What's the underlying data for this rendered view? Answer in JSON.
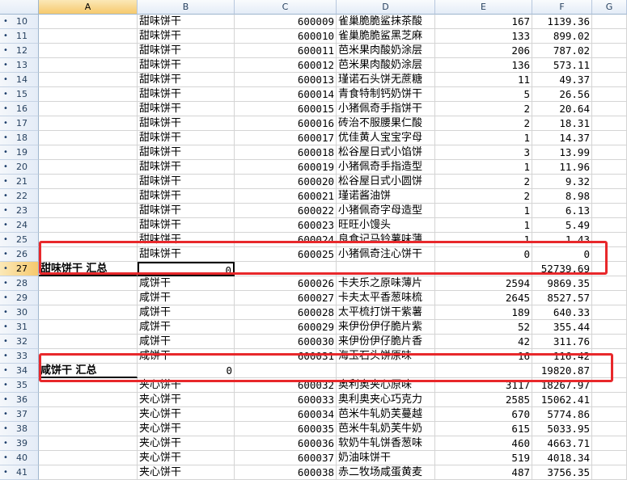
{
  "columns": [
    "A",
    "B",
    "C",
    "D",
    "E",
    "F",
    "G"
  ],
  "selected_column": "A",
  "rows": [
    {
      "row": "10",
      "a": "",
      "b": "甜味饼干",
      "c": "600009",
      "d": "雀巢脆脆鲨抹茶酸",
      "e": "167",
      "f": "1139.36"
    },
    {
      "row": "11",
      "a": "",
      "b": "甜味饼干",
      "c": "600010",
      "d": "雀巢脆脆鲨黑芝麻",
      "e": "133",
      "f": "899.02"
    },
    {
      "row": "12",
      "a": "",
      "b": "甜味饼干",
      "c": "600011",
      "d": "芭米果肉酸奶涂层",
      "e": "206",
      "f": "787.02"
    },
    {
      "row": "13",
      "a": "",
      "b": "甜味饼干",
      "c": "600012",
      "d": "芭米果肉酸奶涂层",
      "e": "136",
      "f": "573.11"
    },
    {
      "row": "14",
      "a": "",
      "b": "甜味饼干",
      "c": "600013",
      "d": "瑾诺石头饼无蔗糖",
      "e": "11",
      "f": "49.37"
    },
    {
      "row": "15",
      "a": "",
      "b": "甜味饼干",
      "c": "600014",
      "d": "青食特制钙奶饼干",
      "e": "5",
      "f": "26.56"
    },
    {
      "row": "16",
      "a": "",
      "b": "甜味饼干",
      "c": "600015",
      "d": "小猪佩奇手指饼干",
      "e": "2",
      "f": "20.64"
    },
    {
      "row": "17",
      "a": "",
      "b": "甜味饼干",
      "c": "600016",
      "d": "砖治不服腰果仁酸",
      "e": "2",
      "f": "18.31"
    },
    {
      "row": "18",
      "a": "",
      "b": "甜味饼干",
      "c": "600017",
      "d": "优佳黄人宝宝字母",
      "e": "1",
      "f": "14.37"
    },
    {
      "row": "19",
      "a": "",
      "b": "甜味饼干",
      "c": "600018",
      "d": "松谷屋日式小馅饼",
      "e": "3",
      "f": "13.99"
    },
    {
      "row": "20",
      "a": "",
      "b": "甜味饼干",
      "c": "600019",
      "d": "小猪佩奇手指造型",
      "e": "1",
      "f": "11.96"
    },
    {
      "row": "21",
      "a": "",
      "b": "甜味饼干",
      "c": "600020",
      "d": "松谷屋日式小圆饼",
      "e": "2",
      "f": "9.32"
    },
    {
      "row": "22",
      "a": "",
      "b": "甜味饼干",
      "c": "600021",
      "d": "瑾诺酱油饼",
      "e": "2",
      "f": "8.98"
    },
    {
      "row": "23",
      "a": "",
      "b": "甜味饼干",
      "c": "600022",
      "d": "小猪佩奇字母造型",
      "e": "1",
      "f": "6.13"
    },
    {
      "row": "24",
      "a": "",
      "b": "甜味饼干",
      "c": "600023",
      "d": "旺旺小馒头",
      "e": "1",
      "f": "5.49"
    },
    {
      "row": "25",
      "a": "",
      "b": "甜味饼干",
      "c": "600024",
      "d": "良食记马铃薯味薄",
      "e": "1",
      "f": "1.43"
    },
    {
      "row": "26",
      "a": "",
      "b": "甜味饼干",
      "c": "600025",
      "d": "小猪佩奇注心饼干",
      "e": "0",
      "f": "0"
    },
    {
      "row": "27",
      "a": "甜味饼干 汇总",
      "b": "0",
      "c": "",
      "d": "",
      "e": "",
      "f": "52739.69",
      "summary": true
    },
    {
      "row": "28",
      "a": "",
      "b": "咸饼干",
      "c": "600026",
      "d": "卡夫乐之原味薄片",
      "e": "2594",
      "f": "9869.35"
    },
    {
      "row": "29",
      "a": "",
      "b": "咸饼干",
      "c": "600027",
      "d": "卡夫太平香葱味梳",
      "e": "2645",
      "f": "8527.57"
    },
    {
      "row": "30",
      "a": "",
      "b": "咸饼干",
      "c": "600028",
      "d": "太平梳打饼干紫薯",
      "e": "189",
      "f": "640.33"
    },
    {
      "row": "31",
      "a": "",
      "b": "咸饼干",
      "c": "600029",
      "d": "来伊份伊仔脆片紫",
      "e": "52",
      "f": "355.44"
    },
    {
      "row": "32",
      "a": "",
      "b": "咸饼干",
      "c": "600030",
      "d": "来伊份伊仔脆片香",
      "e": "42",
      "f": "311.76"
    },
    {
      "row": "33",
      "a": "",
      "b": "咸饼干",
      "c": "600031",
      "d": "海玉石头饼原味",
      "e": "16",
      "f": "116.42"
    },
    {
      "row": "34",
      "a": "咸饼干 汇总",
      "b": "0",
      "c": "",
      "d": "",
      "e": "",
      "f": "19820.87",
      "summary": true
    },
    {
      "row": "35",
      "a": "",
      "b": "夹心饼干",
      "c": "600032",
      "d": "奥利奥夹心原味",
      "e": "3117",
      "f": "18267.97"
    },
    {
      "row": "36",
      "a": "",
      "b": "夹心饼干",
      "c": "600033",
      "d": "奥利奥夹心巧克力",
      "e": "2585",
      "f": "15062.41"
    },
    {
      "row": "37",
      "a": "",
      "b": "夹心饼干",
      "c": "600034",
      "d": "芭米牛轧奶芙蔓越",
      "e": "670",
      "f": "5774.86"
    },
    {
      "row": "38",
      "a": "",
      "b": "夹心饼干",
      "c": "600035",
      "d": "芭米牛轧奶芙牛奶",
      "e": "615",
      "f": "5033.95"
    },
    {
      "row": "39",
      "a": "",
      "b": "夹心饼干",
      "c": "600036",
      "d": "软奶牛轧饼香葱味",
      "e": "460",
      "f": "4663.71"
    },
    {
      "row": "40",
      "a": "",
      "b": "夹心饼干",
      "c": "600037",
      "d": "奶油味饼干",
      "e": "519",
      "f": "4018.34"
    },
    {
      "row": "41",
      "a": "",
      "b": "夹心饼干",
      "c": "600038",
      "d": "赤二牧场咸蛋黄麦",
      "e": "487",
      "f": "3756.35"
    }
  ],
  "colors": {
    "highlight": "#e8282b",
    "grid": "#d4d4d4",
    "header": "#e4ecf7"
  }
}
